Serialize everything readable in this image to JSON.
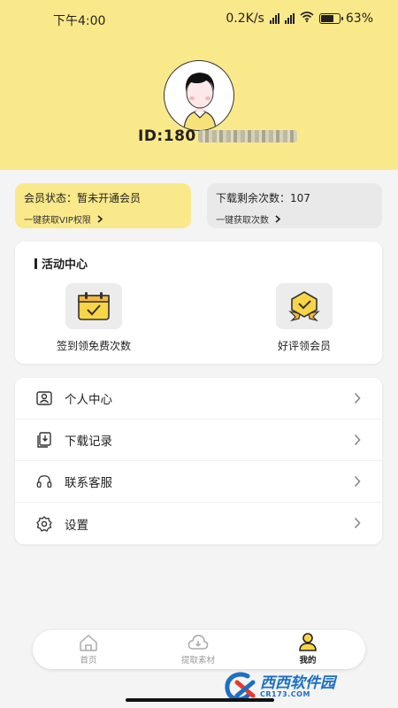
{
  "status_bar": {
    "time": "下午4:00",
    "network_speed": "0.2K/s",
    "battery": "63",
    "battery_level": 0.63
  },
  "profile": {
    "id_prefix": "ID:180"
  },
  "vip_card": {
    "title": "会员状态：暂未开通会员",
    "subtitle": "一键获取VIP权限",
    "bg_color": "#fae98a"
  },
  "download_card": {
    "title": "下载剩余次数：107",
    "subtitle": "一键获取次数"
  },
  "activity": {
    "title": "活动中心",
    "items": [
      {
        "label": "签到领免费次数",
        "icon": "calendar-check-icon"
      },
      {
        "label": "好评领会员",
        "icon": "badge-check-icon"
      }
    ]
  },
  "menu": [
    {
      "label": "个人中心",
      "icon": "user-profile-icon"
    },
    {
      "label": "下载记录",
      "icon": "download-record-icon"
    },
    {
      "label": "联系客服",
      "icon": "headset-icon"
    },
    {
      "label": "设置",
      "icon": "gear-icon"
    }
  ],
  "tabs": [
    {
      "label": "首页",
      "icon": "home-icon",
      "active": false
    },
    {
      "label": "提取素材",
      "icon": "cloud-download-icon",
      "active": false
    },
    {
      "label": "我的",
      "icon": "person-icon",
      "active": true
    }
  ],
  "watermark": {
    "text": "西西软件园",
    "url": "CR173.COM"
  },
  "colors": {
    "accent": "#fae98a",
    "background": "#f4f4f4"
  }
}
